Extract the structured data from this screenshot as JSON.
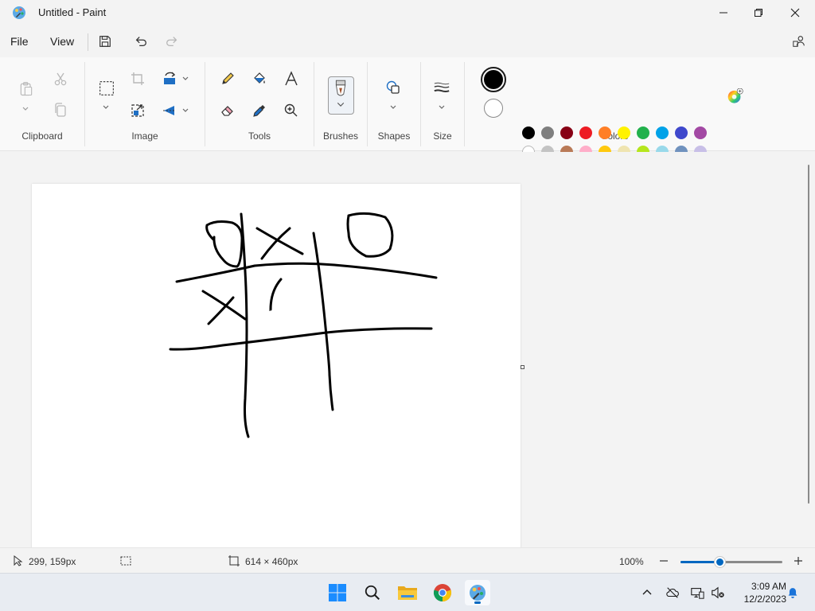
{
  "window": {
    "title": "Untitled - Paint"
  },
  "menu": {
    "file": "File",
    "view": "View"
  },
  "ribbon": {
    "groups": {
      "clipboard": "Clipboard",
      "image": "Image",
      "tools": "Tools",
      "brushes": "Brushes",
      "shapes": "Shapes",
      "size": "Size",
      "colors": "Colors"
    }
  },
  "colors": {
    "color1": "#000000",
    "color2": "#ffffff",
    "palette_row1": [
      "#000000",
      "#7f7f7f",
      "#880015",
      "#ed1c24",
      "#ff7f27",
      "#fff200",
      "#22b14c",
      "#00a2e8",
      "#3f48cc",
      "#a349a4"
    ],
    "palette_row2": [
      "#ffffff",
      "#c3c3c3",
      "#b97a57",
      "#ffaec9",
      "#ffc90e",
      "#efe4b0",
      "#b5e61d",
      "#99d9ea",
      "#7092be",
      "#c8bfe7"
    ],
    "palette_row3_empty_count": 10
  },
  "canvas": {
    "drawing": "tic-tac-toe board sketch in black brush strokes"
  },
  "status": {
    "cursor_position": "299, 159px",
    "selection_size": "",
    "canvas_size": "614 × 460px",
    "zoom": "100%",
    "zoom_level_fraction": 0.38
  },
  "taskbar": {
    "apps": [
      "start-icon",
      "search-icon",
      "file-explorer-icon",
      "chrome-icon",
      "paint-icon"
    ],
    "time": "3:09 AM",
    "date": "12/2/2023"
  }
}
